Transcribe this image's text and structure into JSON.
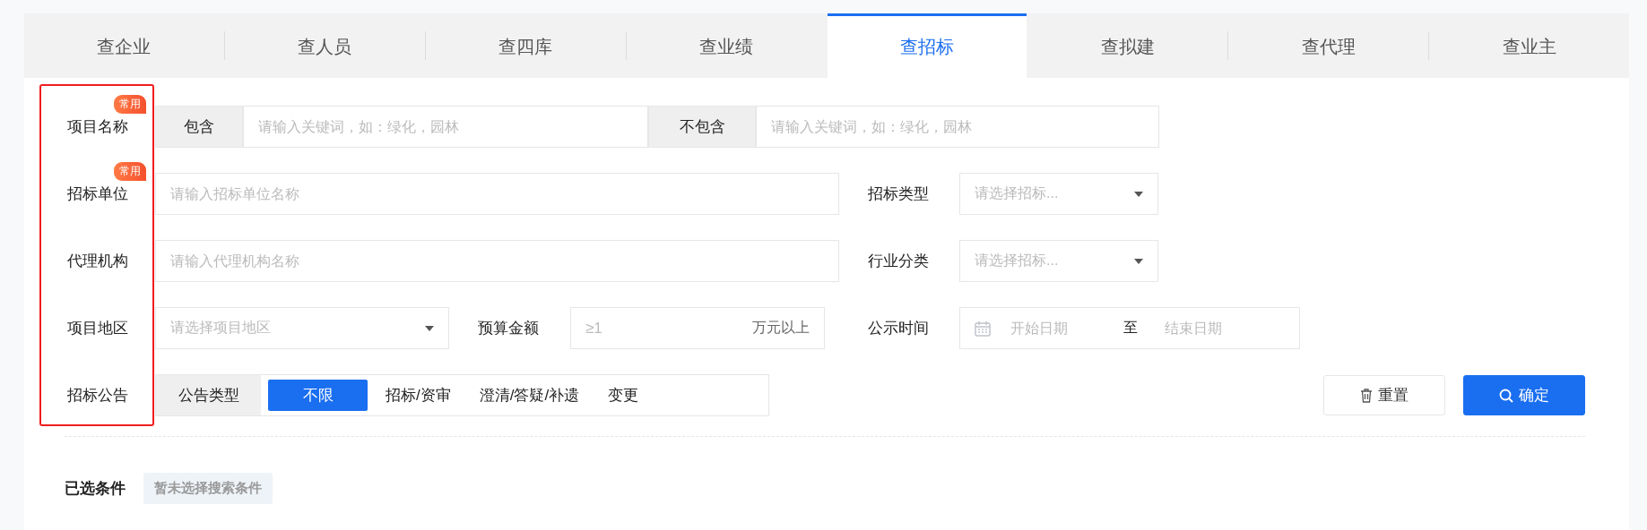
{
  "tabs": [
    {
      "label": "查企业",
      "selected": false
    },
    {
      "label": "查人员",
      "selected": false
    },
    {
      "label": "查四库",
      "selected": false
    },
    {
      "label": "查业绩",
      "selected": false
    },
    {
      "label": "查招标",
      "selected": true
    },
    {
      "label": "查拟建",
      "selected": false
    },
    {
      "label": "查代理",
      "selected": false
    },
    {
      "label": "查业主",
      "selected": false
    }
  ],
  "filters": [
    {
      "kind": "keyword",
      "label": "项目名称",
      "badge": "常用",
      "include": {
        "label": "包含",
        "placeholder": "请输入关键词，如：绿化，园林"
      },
      "exclude": {
        "label": "不包含",
        "placeholder": "请输入关键词，如：绿化，园林"
      }
    },
    {
      "kind": "text_select",
      "label": "招标单位",
      "badge": "常用",
      "placeholder": "请输入招标单位名称",
      "select": {
        "label": "招标类型",
        "placeholder": "请选择招标..."
      }
    },
    {
      "kind": "text_select",
      "label": "代理机构",
      "placeholder": "请输入代理机构名称",
      "select": {
        "label": "行业分类",
        "placeholder": "请选择招标..."
      }
    },
    {
      "kind": "region",
      "label": "项目地区",
      "placeholder": "请选择项目地区",
      "budget": {
        "label": "预算金额",
        "placeholder": "≥1",
        "unit": "万元以上"
      },
      "date": {
        "label": "公示时间",
        "start_placeholder": "开始日期",
        "separator": "至",
        "end_placeholder": "结束日期"
      }
    },
    {
      "kind": "options",
      "label": "招标公告",
      "group_label": "公告类型",
      "options": [
        {
          "label": "不限",
          "selected": true
        },
        {
          "label": "招标/资审",
          "selected": false
        },
        {
          "label": "澄清/答疑/补遗",
          "selected": false
        },
        {
          "label": "变更",
          "selected": false
        }
      ]
    }
  ],
  "actions": {
    "reset": "重置",
    "confirm": "确定"
  },
  "selected_conditions": {
    "label": "已选条件",
    "empty_text": "暂未选择搜索条件"
  }
}
